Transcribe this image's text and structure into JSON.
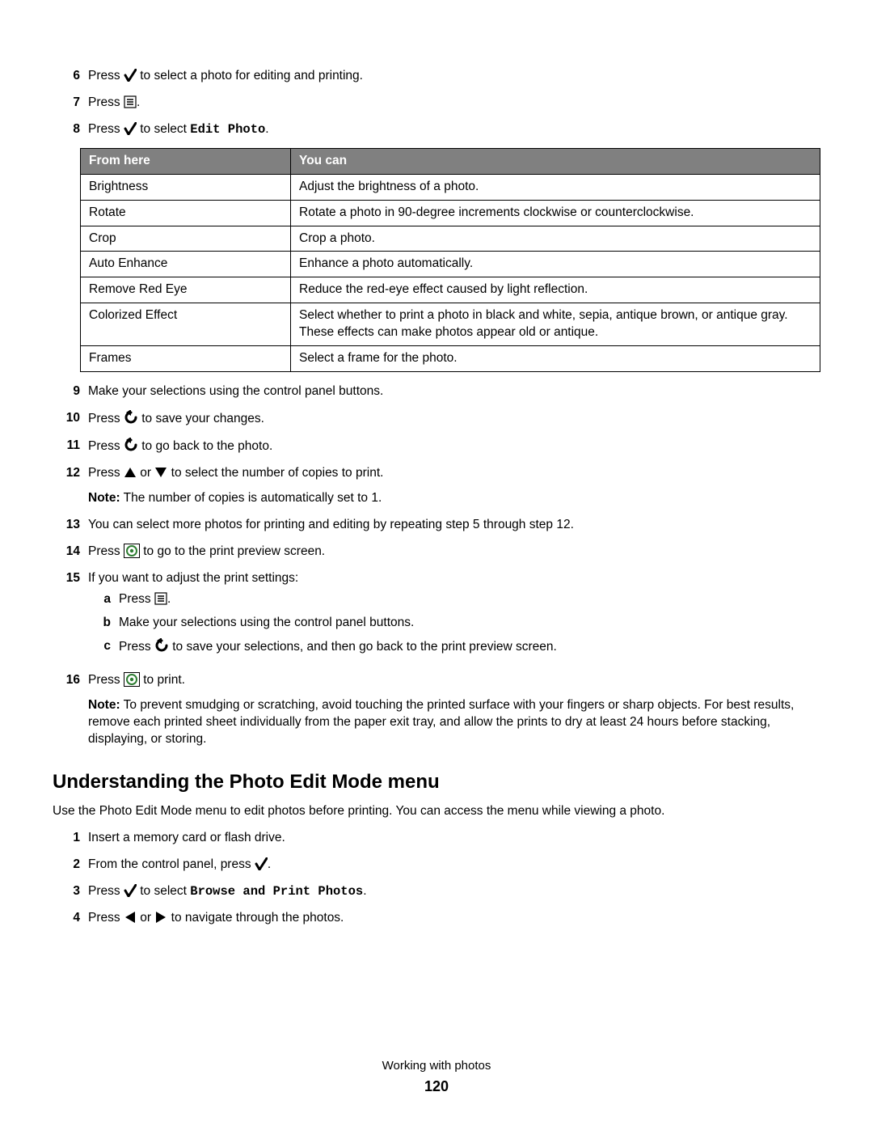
{
  "steps_top": [
    {
      "n": "6",
      "pre": "Press ",
      "icon": "check",
      "post": " to select a photo for editing and printing."
    },
    {
      "n": "7",
      "pre": "Press ",
      "icon": "menu",
      "post": "."
    },
    {
      "n": "8",
      "pre": "Press ",
      "icon": "check",
      "post": " to select ",
      "mono": "Edit Photo",
      "tail": "."
    }
  ],
  "table": {
    "h1": "From here",
    "h2": "You can",
    "rows": [
      [
        "Brightness",
        "Adjust the brightness of a photo."
      ],
      [
        "Rotate",
        "Rotate a photo in 90-degree increments clockwise or counterclockwise."
      ],
      [
        "Crop",
        "Crop a photo."
      ],
      [
        "Auto Enhance",
        "Enhance a photo automatically."
      ],
      [
        "Remove Red Eye",
        "Reduce the red-eye effect caused by light reflection."
      ],
      [
        "Colorized Effect",
        "Select whether to print a photo in black and white, sepia, antique brown, or antique gray. These effects can make photos appear old or antique."
      ],
      [
        "Frames",
        "Select a frame for the photo."
      ]
    ]
  },
  "steps_mid": {
    "s9": {
      "n": "9",
      "text": "Make your selections using the control panel buttons."
    },
    "s10": {
      "n": "10",
      "pre": "Press ",
      "icon": "back",
      "post": " to save your changes."
    },
    "s11": {
      "n": "11",
      "pre": "Press ",
      "icon": "back",
      "post": " to go back to the photo."
    },
    "s12": {
      "n": "12",
      "pre": "Press ",
      "icon": "up",
      "mid": " or ",
      "icon2": "down",
      "post": " to select the number of copies to print.",
      "note_label": "Note:",
      "note": " The number of copies is automatically set to 1."
    },
    "s13": {
      "n": "13",
      "text": "You can select more photos for printing and editing by repeating step 5 through step 12."
    },
    "s14": {
      "n": "14",
      "pre": "Press ",
      "icon": "start",
      "post": " to go to the print preview screen."
    },
    "s15": {
      "n": "15",
      "text": "If you want to adjust the print settings:",
      "subs": [
        {
          "l": "a",
          "pre": "Press ",
          "icon": "menu",
          "post": "."
        },
        {
          "l": "b",
          "text": "Make your selections using the control panel buttons."
        },
        {
          "l": "c",
          "pre": "Press ",
          "icon": "back",
          "post": " to save your selections, and then go back to the print preview screen."
        }
      ]
    },
    "s16": {
      "n": "16",
      "pre": "Press ",
      "icon": "start",
      "post": " to print.",
      "note_label": "Note:",
      "note": " To prevent smudging or scratching, avoid touching the printed surface with your fingers or sharp objects. For best results, remove each printed sheet individually from the paper exit tray, and allow the prints to dry at least 24 hours before stacking, displaying, or storing."
    }
  },
  "section2": {
    "title": "Understanding the Photo Edit Mode menu",
    "intro": "Use the Photo Edit Mode menu to edit photos before printing. You can access the menu while viewing a photo.",
    "steps": {
      "s1": {
        "n": "1",
        "text": "Insert a memory card or flash drive."
      },
      "s2": {
        "n": "2",
        "pre": "From the control panel, press ",
        "icon": "check",
        "post": "."
      },
      "s3": {
        "n": "3",
        "pre": "Press ",
        "icon": "check",
        "post": " to select ",
        "mono": "Browse and Print Photos",
        "tail": "."
      },
      "s4": {
        "n": "4",
        "pre": "Press ",
        "icon": "left",
        "mid": " or ",
        "icon2": "right",
        "post": " to navigate through the photos."
      }
    }
  },
  "footer": {
    "text": "Working with photos",
    "page": "120"
  }
}
